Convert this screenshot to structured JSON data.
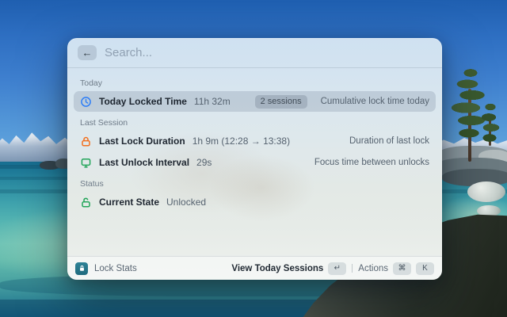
{
  "window": {
    "search": {
      "placeholder": "Search..."
    },
    "icons": {
      "back": "←"
    },
    "sections": [
      {
        "label": "Today",
        "rows": [
          {
            "icon": "clock-icon",
            "title": "Today Locked Time",
            "value": "11h 32m",
            "badge": "2 sessions",
            "accessory": "Cumulative lock time today",
            "selected": true
          }
        ]
      },
      {
        "label": "Last Session",
        "rows": [
          {
            "icon": "lock-closed-icon",
            "title": "Last Lock Duration",
            "value": "1h 9m (12:28 → 13:38)",
            "accessory": "Duration of last lock",
            "selected": false
          },
          {
            "icon": "monitor-icon",
            "title": "Last Unlock Interval",
            "value": "29s",
            "accessory": "Focus time between unlocks",
            "selected": false
          }
        ]
      },
      {
        "label": "Status",
        "rows": [
          {
            "icon": "lock-open-icon",
            "title": "Current State",
            "value": "Unlocked",
            "selected": false
          }
        ]
      }
    ],
    "footer": {
      "app_name": "Lock Stats",
      "primary_action": "View Today Sessions",
      "primary_key": "↵",
      "secondary_action": "Actions",
      "secondary_keys": [
        "⌘",
        "K"
      ]
    }
  },
  "colors": {
    "accent_blue": "#2f7ff7",
    "accent_orange": "#f2701e",
    "accent_green": "#23a55a",
    "app_icon_teal": "#2b7e92",
    "selection_gray_blue": "#97a7b8"
  }
}
